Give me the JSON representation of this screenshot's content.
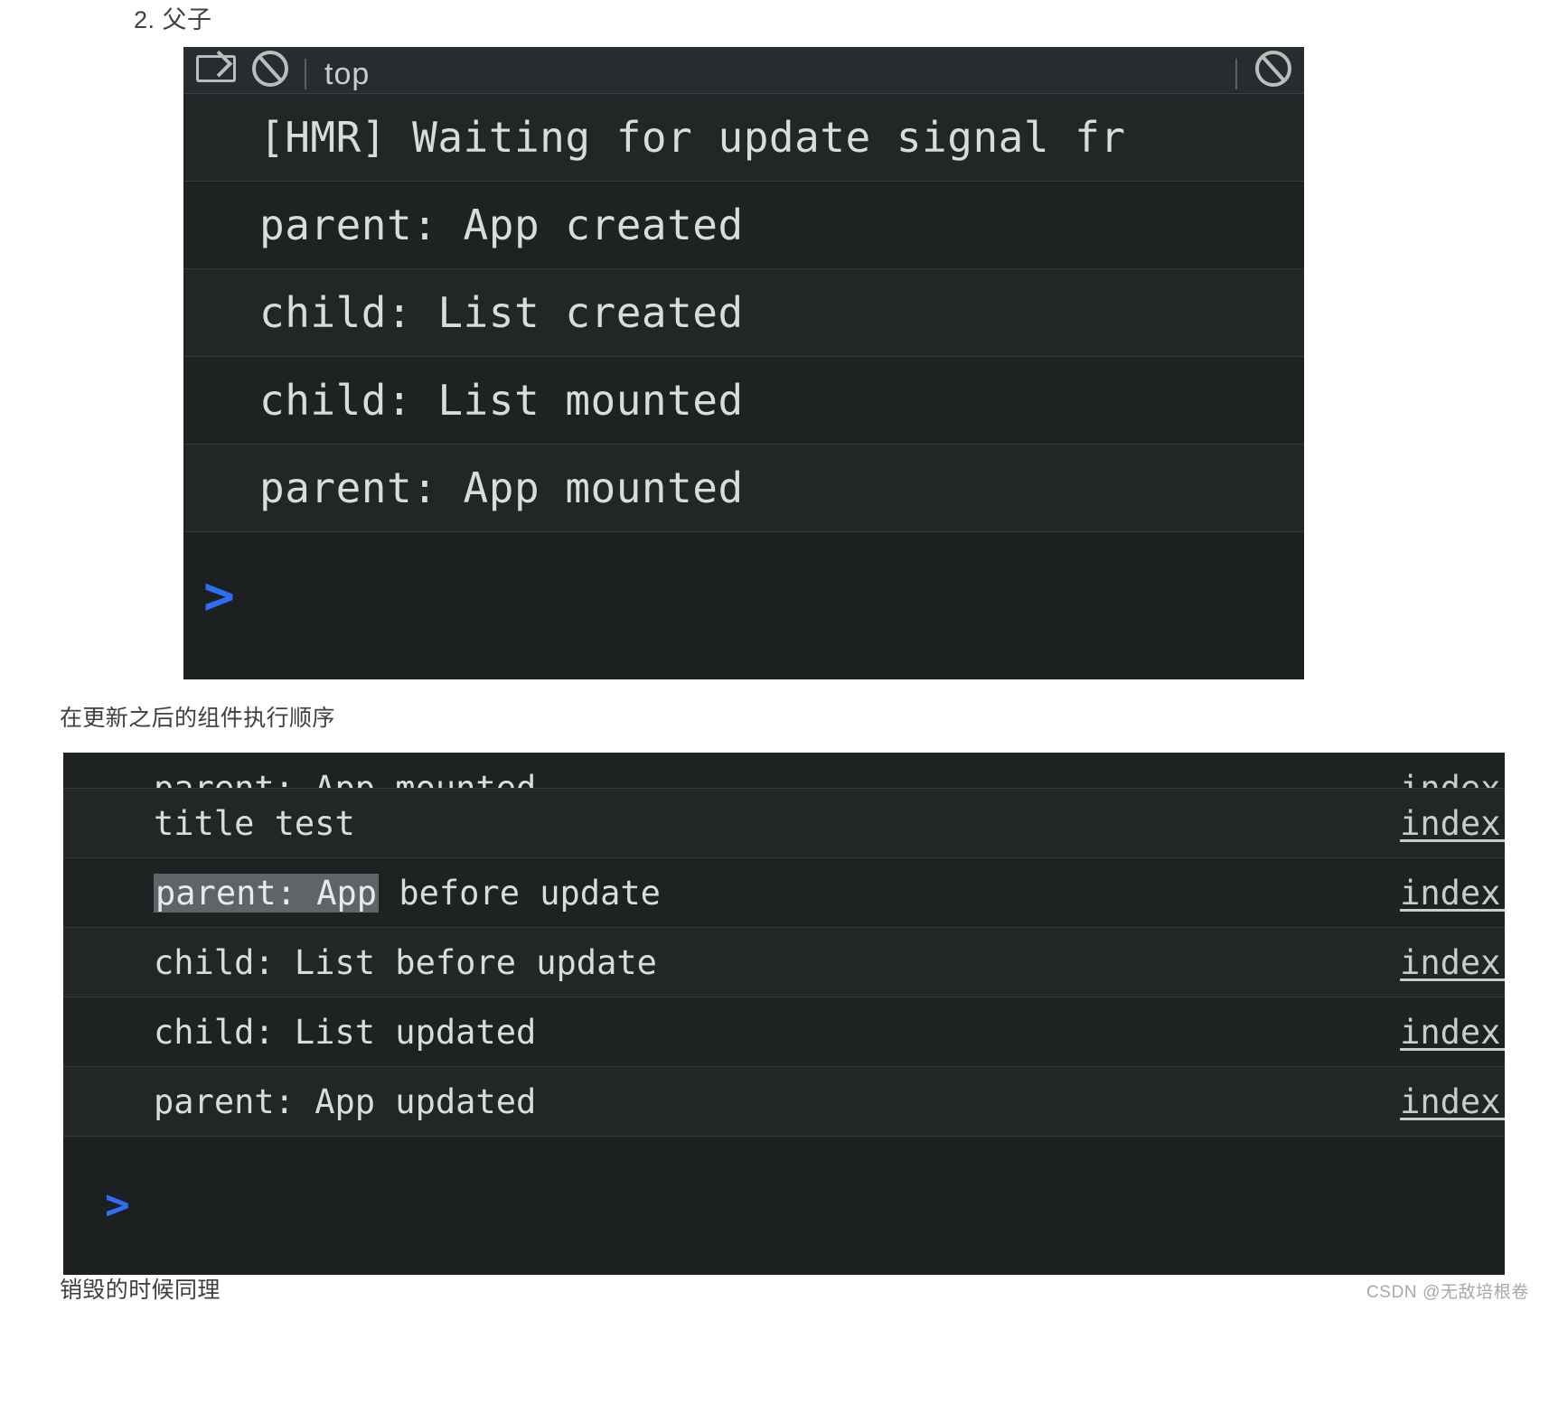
{
  "article": {
    "heading": "2. 父子",
    "caption_after_update": "在更新之后的组件执行顺序",
    "caption_destroy": "销毁的时候同理",
    "watermark": "CSDN @无敌培根卷"
  },
  "console_1": {
    "toolbar": {
      "device_icon": "device-toolbar-icon",
      "clear_icon": "clear-console-icon",
      "context_label": "top",
      "settings_icon": "settings-icon"
    },
    "rows": [
      {
        "text": "[HMR] Waiting for update signal fr",
        "source": ""
      },
      {
        "text": "parent: App created",
        "source": ""
      },
      {
        "text": "child: List created",
        "source": ""
      },
      {
        "text": "child: List mounted",
        "source": ""
      },
      {
        "text": "parent: App mounted",
        "source": ""
      }
    ],
    "prompt": ">"
  },
  "console_2": {
    "rows": [
      {
        "text": "parent: App mounted",
        "source": "index.j",
        "clipped": true
      },
      {
        "text": "title test",
        "source": "index.j"
      },
      {
        "selected": "parent: App",
        "text": " before update",
        "source": "index.j"
      },
      {
        "text": "child: List before update",
        "source": "index.j"
      },
      {
        "text": "child: List updated",
        "source": "index.j"
      },
      {
        "text": "parent: App updated",
        "source": "index.j"
      }
    ],
    "prompt": ">"
  }
}
